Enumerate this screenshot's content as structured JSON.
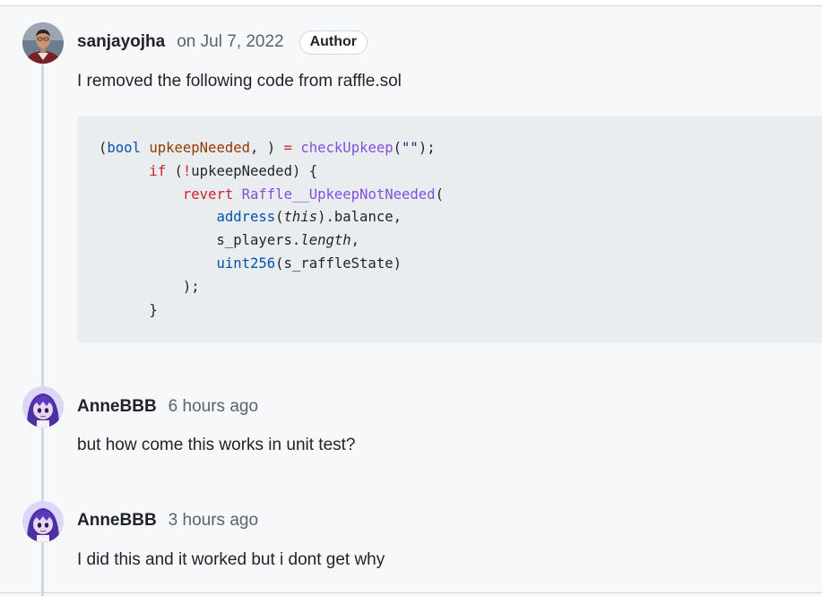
{
  "comments": [
    {
      "author": "sanjayojha",
      "timestamp": "on Jul 7, 2022",
      "badge": "Author",
      "avatar_icon": "person-photo-avatar",
      "body": "I removed the following code from raffle.sol"
    },
    {
      "author": "AnneBBB",
      "timestamp": "6 hours ago",
      "avatar_icon": "anime-girl-avatar",
      "body": "but how come this works in unit test?"
    },
    {
      "author": "AnneBBB",
      "timestamp": "3 hours ago",
      "avatar_icon": "anime-girl-avatar",
      "body": "I did this and it worked but i dont get why"
    }
  ],
  "code": {
    "language": "solidity",
    "lines": [
      [
        {
          "t": "(",
          "c": ""
        },
        {
          "t": "bool",
          "c": "type"
        },
        {
          "t": " ",
          "c": ""
        },
        {
          "t": "upkeepNeeded",
          "c": "var"
        },
        {
          "t": ", ) ",
          "c": ""
        },
        {
          "t": "=",
          "c": "kw"
        },
        {
          "t": " ",
          "c": ""
        },
        {
          "t": "checkUpkeep",
          "c": "fn"
        },
        {
          "t": "(",
          "c": ""
        },
        {
          "t": "\"\"",
          "c": "str"
        },
        {
          "t": ");",
          "c": ""
        }
      ],
      [
        {
          "t": "      ",
          "c": ""
        },
        {
          "t": "if",
          "c": "kw"
        },
        {
          "t": " (",
          "c": ""
        },
        {
          "t": "!",
          "c": "kw"
        },
        {
          "t": "upkeepNeeded) {",
          "c": ""
        }
      ],
      [
        {
          "t": "          ",
          "c": ""
        },
        {
          "t": "revert",
          "c": "kw"
        },
        {
          "t": " ",
          "c": ""
        },
        {
          "t": "Raffle__UpkeepNotNeeded",
          "c": "fn"
        },
        {
          "t": "(",
          "c": ""
        }
      ],
      [
        {
          "t": "              ",
          "c": ""
        },
        {
          "t": "address",
          "c": "type"
        },
        {
          "t": "(",
          "c": ""
        },
        {
          "t": "this",
          "c": "it"
        },
        {
          "t": ").balance,",
          "c": ""
        }
      ],
      [
        {
          "t": "              s_players.",
          "c": ""
        },
        {
          "t": "length",
          "c": "it"
        },
        {
          "t": ",",
          "c": ""
        }
      ],
      [
        {
          "t": "              ",
          "c": ""
        },
        {
          "t": "uint256",
          "c": "type"
        },
        {
          "t": "(s_raffleState)",
          "c": ""
        }
      ],
      [
        {
          "t": "          );",
          "c": ""
        }
      ],
      [
        {
          "t": "      }",
          "c": ""
        }
      ]
    ]
  }
}
